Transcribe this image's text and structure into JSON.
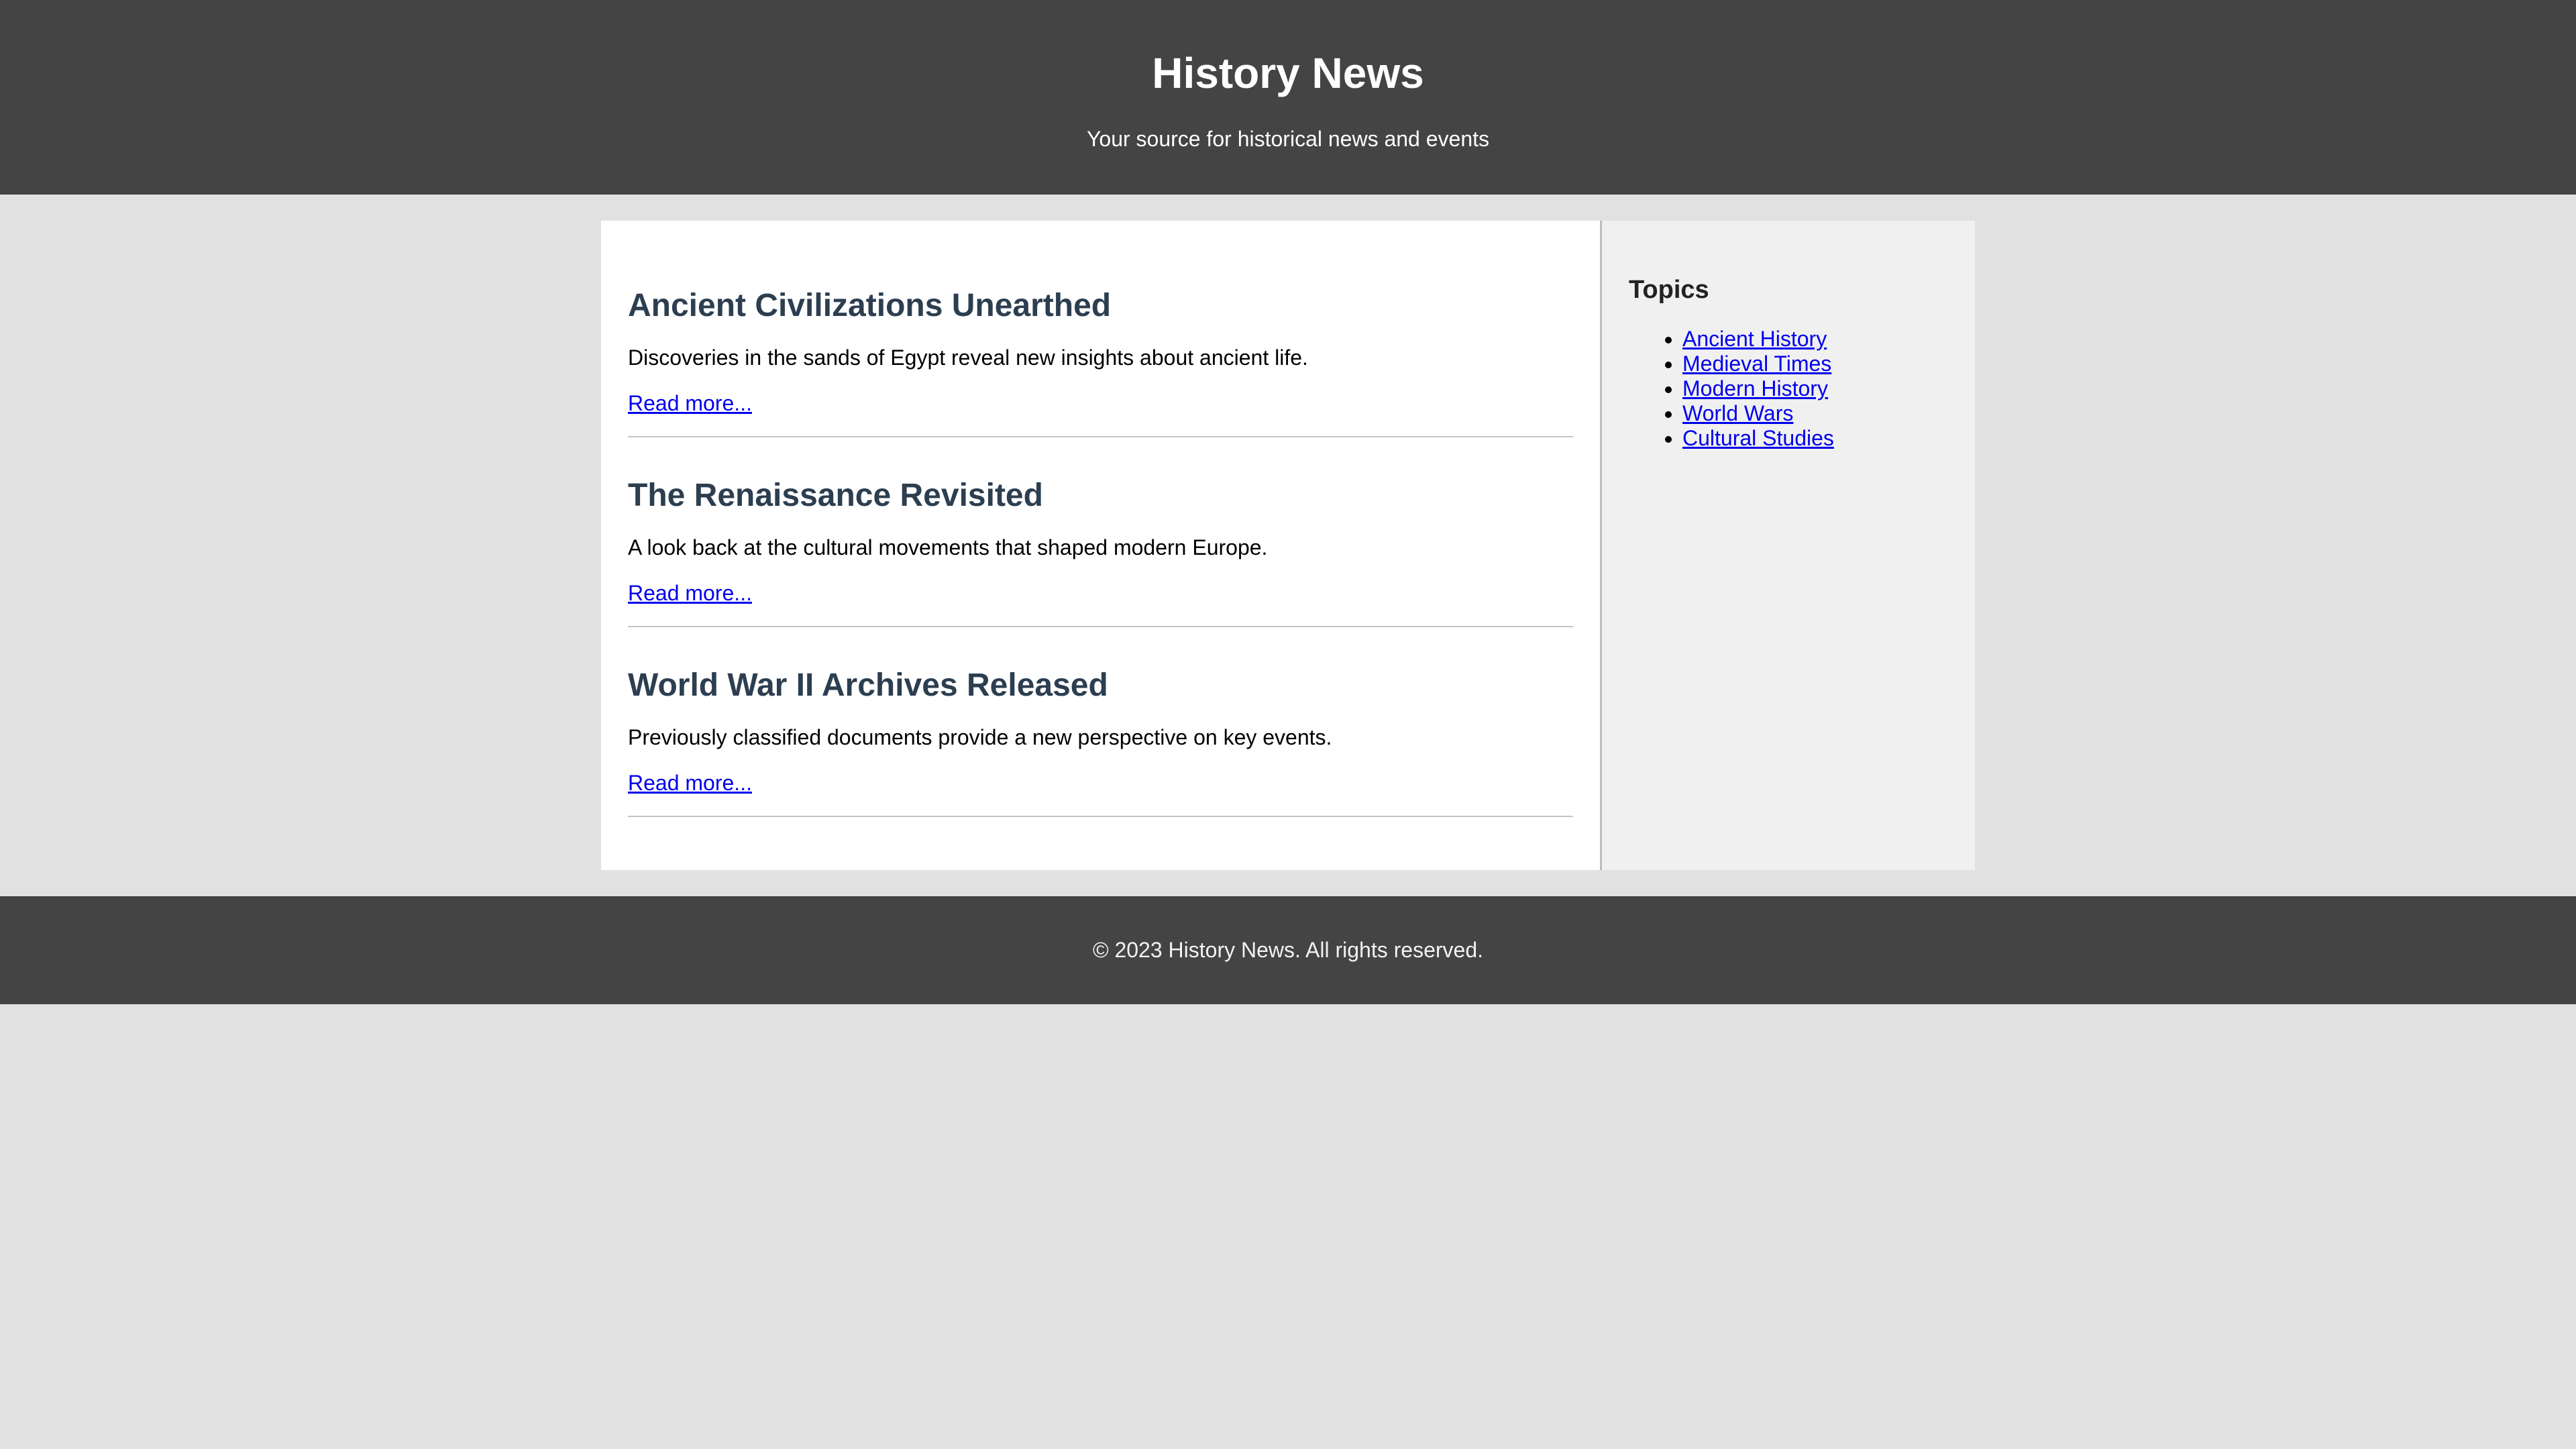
{
  "header": {
    "title": "History News",
    "tagline": "Your source for historical news and events"
  },
  "articles": [
    {
      "title": "Ancient Civilizations Unearthed",
      "summary": "Discoveries in the sands of Egypt reveal new insights about ancient life.",
      "link_label": "Read more..."
    },
    {
      "title": "The Renaissance Revisited",
      "summary": "A look back at the cultural movements that shaped modern Europe.",
      "link_label": "Read more..."
    },
    {
      "title": "World War II Archives Released",
      "summary": "Previously classified documents provide a new perspective on key events.",
      "link_label": "Read more..."
    }
  ],
  "sidebar": {
    "title": "Topics",
    "topics": [
      "Ancient History",
      "Medieval Times",
      "Modern History",
      "World Wars",
      "Cultural Studies"
    ]
  },
  "footer": {
    "text": "© 2023 History News. All rights reserved."
  },
  "colors": {
    "header_bg": "#444444",
    "page_bg": "#e1e1e1",
    "article_title": "#2c3e50",
    "link": "#0000ee",
    "sidebar_bg": "#f0f0f0"
  }
}
